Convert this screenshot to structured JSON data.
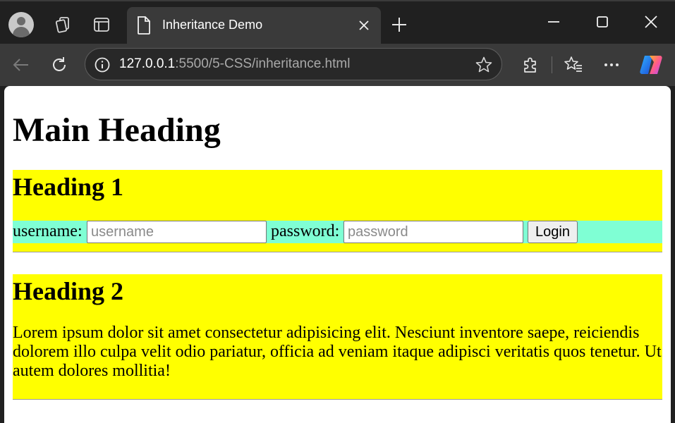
{
  "browser": {
    "tab_title": "Inheritance Demo",
    "url_host": "127.0.0.1",
    "url_path": ":5500/5-CSS/inheritance.html"
  },
  "page": {
    "main_heading": "Main Heading",
    "section1": {
      "heading": "Heading 1",
      "username_label": "username:",
      "username_placeholder": "username",
      "password_label": "password:",
      "password_placeholder": "password",
      "login_label": "Login"
    },
    "section2": {
      "heading": "Heading 2",
      "paragraph": "Lorem ipsum dolor sit amet consectetur adipisicing elit. Nesciunt inventore saepe, reiciendis dolorem illo culpa velit odio pariatur, officia ad veniam itaque adipisci veritatis quos tenetur. Ut autem dolores mollitia!"
    }
  },
  "colors": {
    "section_bg": "#ffff00",
    "form_bg": "#7fffd4"
  }
}
